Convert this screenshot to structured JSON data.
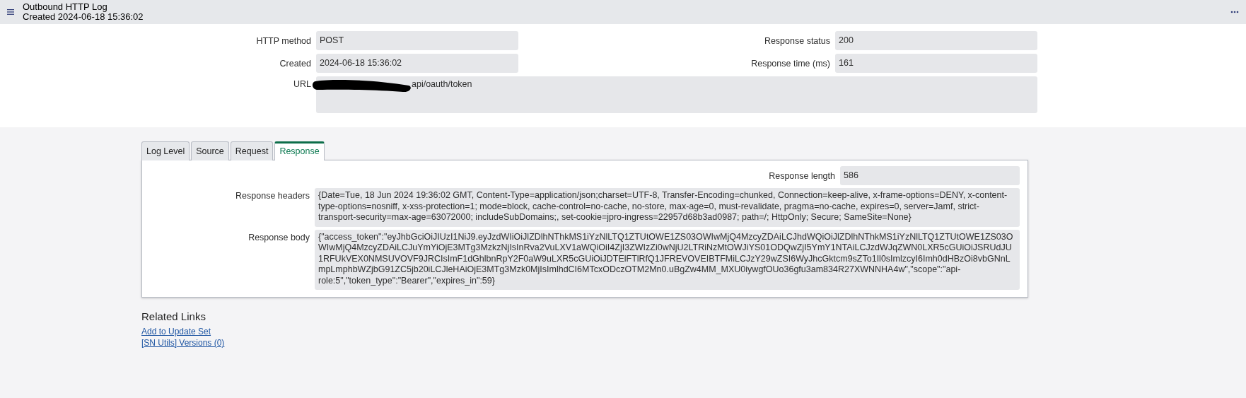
{
  "header": {
    "title": "Outbound HTTP Log",
    "subtitle": "Created 2024-06-18 15:36:02"
  },
  "left_fields": [
    {
      "label": "HTTP method",
      "value": "POST"
    },
    {
      "label": "Created",
      "value": "2024-06-18 15:36:02"
    }
  ],
  "right_fields": [
    {
      "label": "Response status",
      "value": "200"
    },
    {
      "label": "Response time (ms)",
      "value": "161"
    }
  ],
  "url": {
    "label": "URL",
    "value": "api/oauth/token",
    "redacted": true
  },
  "tabs": [
    {
      "label": "Log Level",
      "selected": false
    },
    {
      "label": "Source",
      "selected": false
    },
    {
      "label": "Request",
      "selected": false
    },
    {
      "label": "Response",
      "selected": true
    }
  ],
  "response": {
    "length_label": "Response length",
    "length": "586",
    "headers_label": "Response headers",
    "headers": "{Date=Tue, 18 Jun 2024 19:36:02 GMT, Content-Type=application/json;charset=UTF-8, Transfer-Encoding=chunked, Connection=keep-alive, x-frame-options=DENY, x-content-type-options=nosniff, x-xss-protection=1; mode=block, cache-control=no-cache, no-store, max-age=0, must-revalidate, pragma=no-cache, expires=0, server=Jamf, strict-transport-security=max-age=63072000; includeSubDomains;, set-cookie=jpro-ingress=22957d68b3ad0987; path=/; HttpOnly; Secure; SameSite=None}",
    "body_label": "Response body",
    "body": "{\"access_token\":\"eyJhbGciOiJIUzI1NiJ9.eyJzdWIiOiJlZDlhNThkMS1iYzNlLTQ1ZTUtOWE1ZS03OWIwMjQ4MzcyZDAiLCJhdWQiOiJlZDlhNThkMS1iYzNlLTQ1ZTUtOWE1ZS03OWIwMjQ4MzcyZDAiLCJuYmYiOjE3MTg3MzkzNjIsInRva2VuLXV1aWQiOiI4ZjI3ZWIzZi0wNjU2LTRiNzMtOWJiYS01ODQwZjI5YmY1NTAiLCJzdWJqZWN0LXR5cGUiOiJSRUdJU1RFUkVEX0NMSUVOVF9JRCIsImF1dGhlbnRpY2F0aW9uLXR5cGUiOiJDTElFTlRfQ1JFREVOVEIBTFMiLCJzY29wZSI6WyJhcGktcm9sZTo1Il0sImlzcyI6Imh0dHBzOi8vbGNnLmpLmphbWZjbG91ZC5jb20iLCJleHAiOjE3MTg3Mzk0MjIsImlhdCI6MTcxODczOTM2Mn0.uBgZw4MM_MXU0iywgfOUo36gfu3am834R27XWNNHA4w\",\"scope\":\"api-role:5\",\"token_type\":\"Bearer\",\"expires_in\":59}"
  },
  "related_links": {
    "title": "Related Links",
    "links": [
      "Add to Update Set",
      "[SN Utils] Versions (0)"
    ]
  }
}
